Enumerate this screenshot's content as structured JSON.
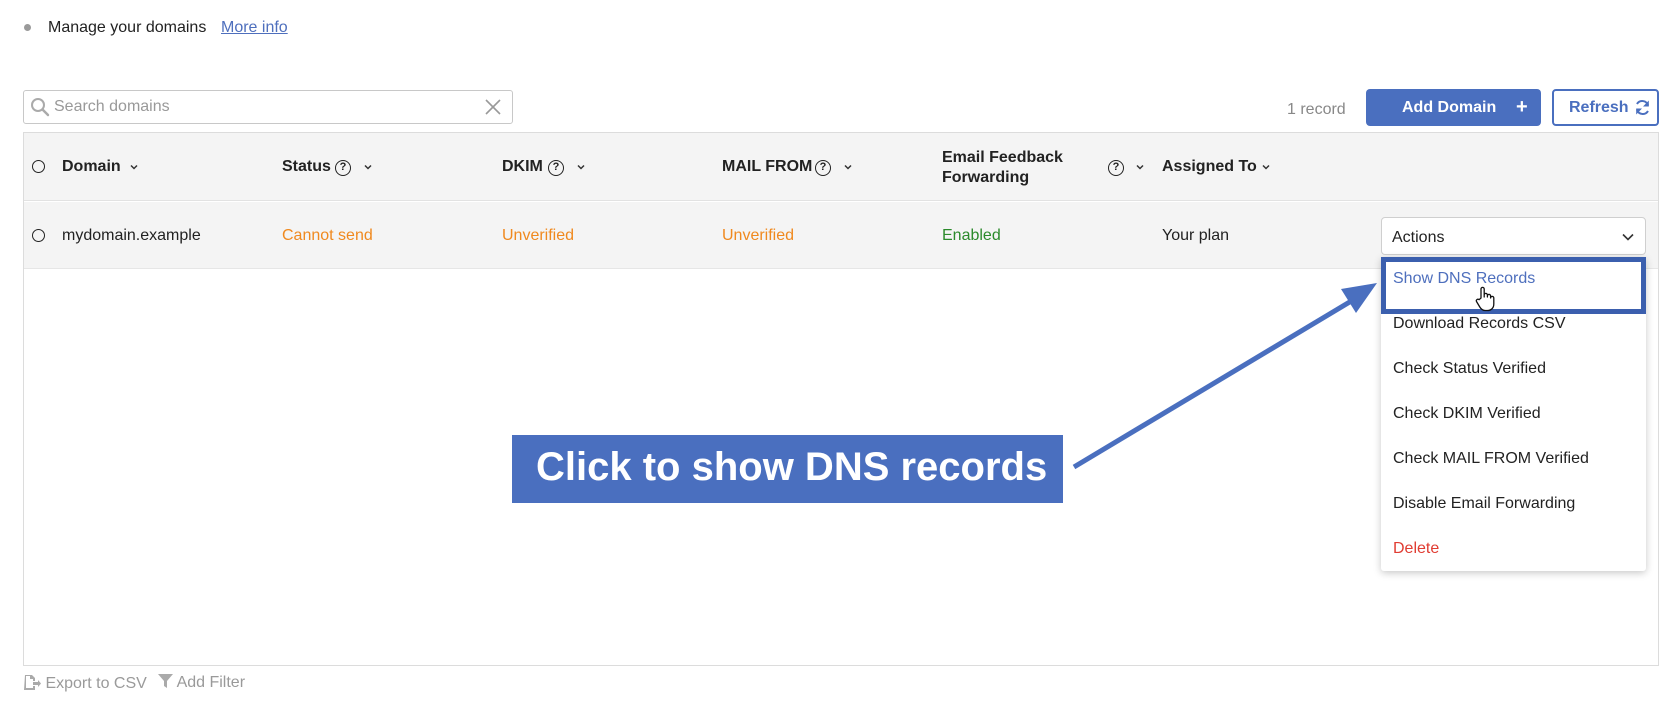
{
  "info": {
    "text": "Manage your domains",
    "link": "More info"
  },
  "search": {
    "placeholder": "Search domains",
    "value": ""
  },
  "toolbar": {
    "record_count": "1 record",
    "add_label": "Add Domain",
    "add_plus": "+",
    "refresh_label": "Refresh"
  },
  "table": {
    "headers": {
      "domain": "Domain",
      "status": "Status",
      "dkim": "DKIM",
      "mail_from": "MAIL FROM",
      "feedback_line1": "Email Feedback",
      "feedback_line2": "Forwarding",
      "assigned": "Assigned To"
    },
    "rows": [
      {
        "domain": "mydomain.example",
        "status": "Cannot send",
        "dkim": "Unverified",
        "mail_from": "Unverified",
        "feedback": "Enabled",
        "assigned": "Your plan",
        "actions": "Actions"
      }
    ]
  },
  "menu": {
    "items": [
      "Show DNS Records",
      "Download Records CSV",
      "Check Status Verified",
      "Check DKIM Verified",
      "Check MAIL FROM Verified",
      "Disable Email Forwarding",
      "Delete"
    ]
  },
  "callout": {
    "text": "Click to show DNS records"
  },
  "footer": {
    "export": "Export to CSV",
    "filter": "Add Filter"
  },
  "colors": {
    "accent": "#4a6fbf",
    "warning": "#f0891e",
    "success": "#2b8a2b",
    "danger": "#e03c32",
    "link": "#4e6fbd"
  },
  "icons": [
    "search-icon",
    "clear-icon",
    "plus-icon",
    "refresh-icon",
    "chevron-down-icon",
    "help-icon",
    "hand-pointer-icon",
    "export-icon",
    "filter-icon"
  ]
}
